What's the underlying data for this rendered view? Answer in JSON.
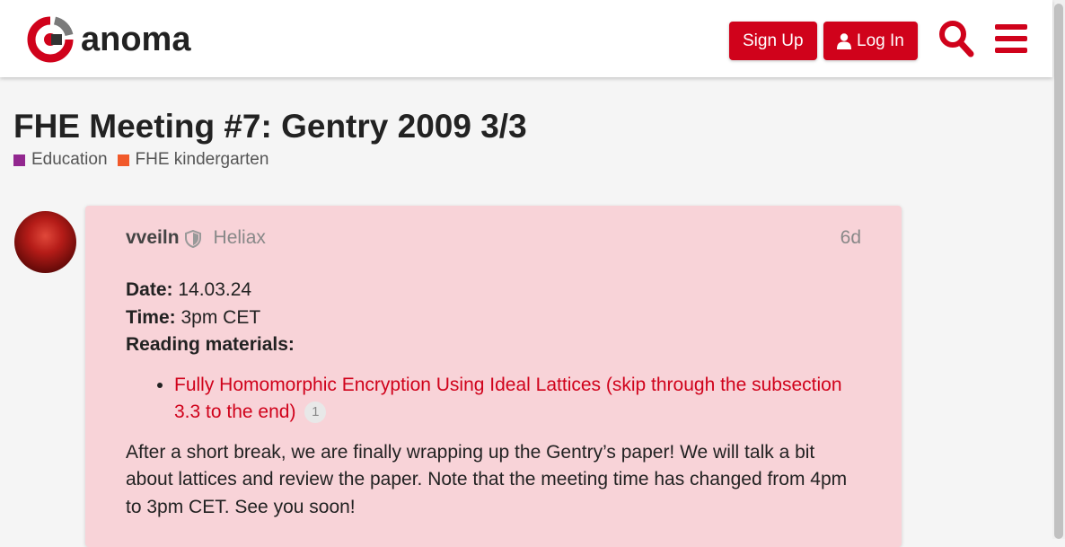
{
  "header": {
    "logo_text": "anoma",
    "signup_label": "Sign Up",
    "login_label": "Log In",
    "icons": [
      "search-icon",
      "hamburger-menu-icon",
      "user-icon"
    ],
    "accent_color": "#d0021b"
  },
  "topic": {
    "title": "FHE Meeting #7: Gentry 2009 3/3",
    "categories": [
      {
        "label": "Education",
        "color": "#92278f"
      },
      {
        "label": "FHE kindergarten",
        "color": "#f1592a"
      }
    ]
  },
  "post": {
    "username": "vveiln",
    "group": "Heliax",
    "age": "6d",
    "date_label": "Date:",
    "date_value": " 14.03.24",
    "time_label": "Time:",
    "time_value": " 3pm CET",
    "reading_label": "Reading materials:",
    "link_text": "Fully Homomorphic Encryption Using Ideal Lattices (skip through the subsection 3.3 to the end)",
    "link_clicks": "1",
    "body_text": "After a short break, we are finally wrapping up the Gentry’s paper! We will talk a bit about lattices and review the paper. Note that the meeting time has changed from 4pm to 3pm CET. See you soon!",
    "background_color": "#f8d3d8"
  }
}
